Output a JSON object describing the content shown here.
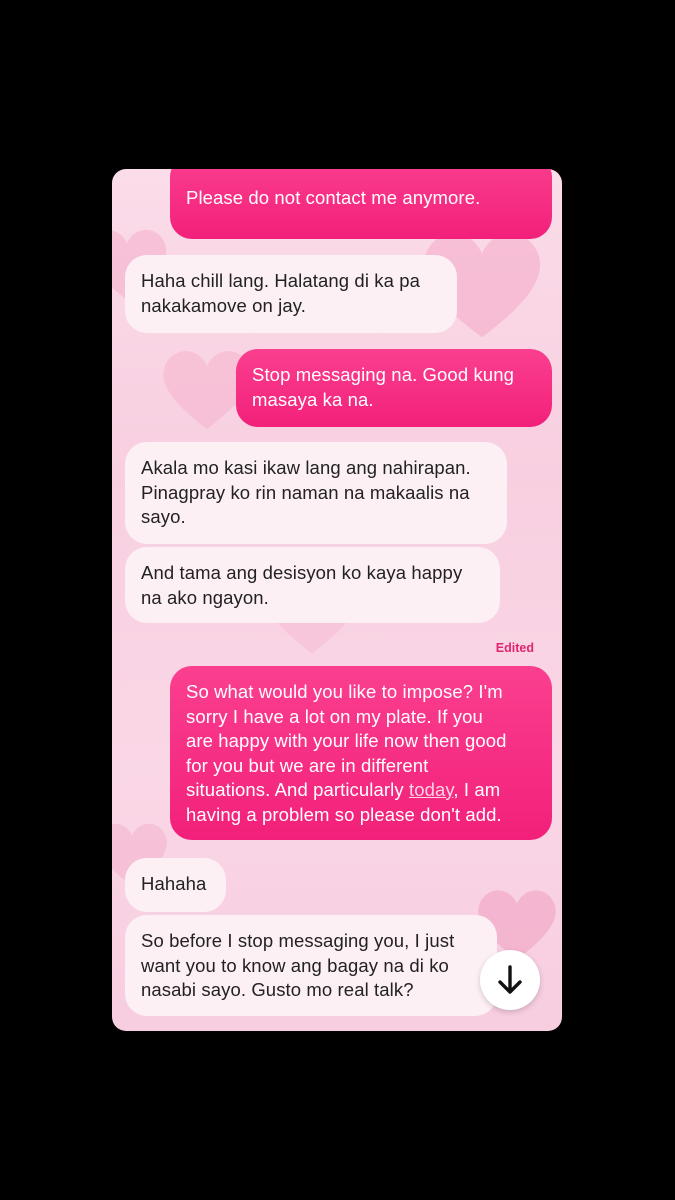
{
  "messages": [
    {
      "direction": "out",
      "lines": [
        "Please do not contact me anymore."
      ]
    },
    {
      "direction": "in",
      "lines": [
        "Haha chill lang. Halatang di ka pa",
        "nakakamove on jay."
      ]
    },
    {
      "direction": "out",
      "lines": [
        "Stop messaging na. Good kung",
        "masaya ka na."
      ]
    },
    {
      "direction": "in",
      "lines": [
        "Akala mo kasi ikaw lang ang nahirapan.",
        "Pinagpray ko rin naman na makaalis na",
        "sayo."
      ]
    },
    {
      "direction": "in",
      "lines": [
        "And tama ang desisyon ko kaya happy",
        "na ako ngayon."
      ]
    },
    {
      "direction": "out",
      "edited_label": "Edited",
      "lines": [
        "So what would you like to impose? I'm",
        "sorry I have a lot on my plate. If you",
        "are happy with your life now then good",
        "for you but we are in different",
        "situations. And particularly ",
        "today",
        ", I am",
        "having a problem so please don't add."
      ]
    },
    {
      "direction": "in",
      "lines": [
        "Hahaha"
      ]
    },
    {
      "direction": "in",
      "lines": [
        "So before I stop messaging you, I just",
        "want you to know ang bagay na di ko",
        "nasabi sayo. Gusto mo real talk?"
      ]
    }
  ],
  "scroll_button_icon": "arrow-down-icon",
  "colors": {
    "outgoing_bubble": "#f52a80",
    "incoming_bubble": "#fdf0f4",
    "edited_label": "#e0256f",
    "background": "#f9d3e3"
  }
}
